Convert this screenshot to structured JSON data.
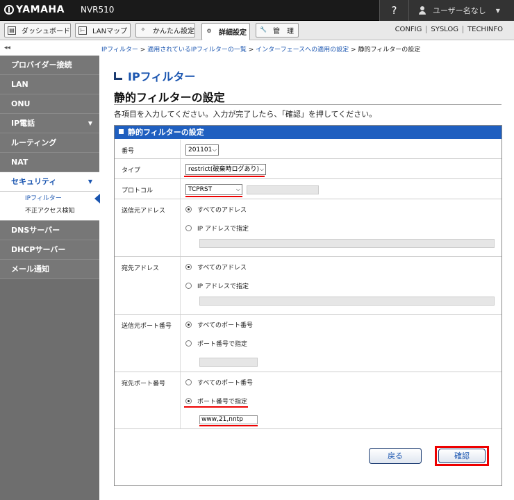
{
  "header": {
    "brand": "YAMAHA",
    "model": "NVR510",
    "help_label": "?",
    "user_label": "ユーザー名なし"
  },
  "menubar": {
    "buttons": [
      {
        "label": "ダッシュボード"
      },
      {
        "label": "LANマップ"
      },
      {
        "label": "かんたん設定"
      },
      {
        "label": "詳細設定"
      },
      {
        "label": "管　理"
      }
    ],
    "links": [
      "CONFIG",
      "SYSLOG",
      "TECHINFO"
    ]
  },
  "breadcrumb": {
    "items": [
      "IPフィルター",
      "適用されているIPフィルターの一覧",
      "インターフェースへの適用の設定"
    ],
    "current": "静的フィルターの設定",
    "separator": ">"
  },
  "sidebar": {
    "collapse_label": "◂◂",
    "items": [
      {
        "label": "プロバイダー接続"
      },
      {
        "label": "LAN"
      },
      {
        "label": "ONU"
      },
      {
        "label": "IP電話"
      },
      {
        "label": "ルーティング"
      },
      {
        "label": "NAT"
      },
      {
        "label": "セキュリティ"
      },
      {
        "label": "DNSサーバー"
      },
      {
        "label": "DHCPサーバー"
      },
      {
        "label": "メール通知"
      }
    ],
    "security_sub": [
      "IPフィルター",
      "不正アクセス検知"
    ]
  },
  "main": {
    "section_title": "IPフィルター",
    "page_title": "静的フィルターの設定",
    "instruction": "各項目を入力してください。入力が完了したら、「確認」を押してください。",
    "form_title": "静的フィルターの設定",
    "fields": {
      "number": {
        "label": "番号",
        "value": "201101"
      },
      "type": {
        "label": "タイプ",
        "value": "restrict(破棄時ログあり)"
      },
      "protocol": {
        "label": "プロトコル",
        "value": "TCPRST"
      },
      "src_address": {
        "label": "送信元アドレス",
        "opt_all": "すべてのアドレス",
        "opt_specify": "IP アドレスで指定"
      },
      "dst_address": {
        "label": "宛先アドレス",
        "opt_all": "すべてのアドレス",
        "opt_specify": "IP アドレスで指定"
      },
      "src_port": {
        "label": "送信元ポート番号",
        "opt_all": "すべてのポート番号",
        "opt_specify": "ポート番号で指定"
      },
      "dst_port": {
        "label": "宛先ポート番号",
        "opt_all": "すべてのポート番号",
        "opt_specify": "ポート番号で指定",
        "value": "www,21,nntp"
      }
    },
    "buttons": {
      "back": "戻る",
      "confirm": "確認"
    }
  }
}
